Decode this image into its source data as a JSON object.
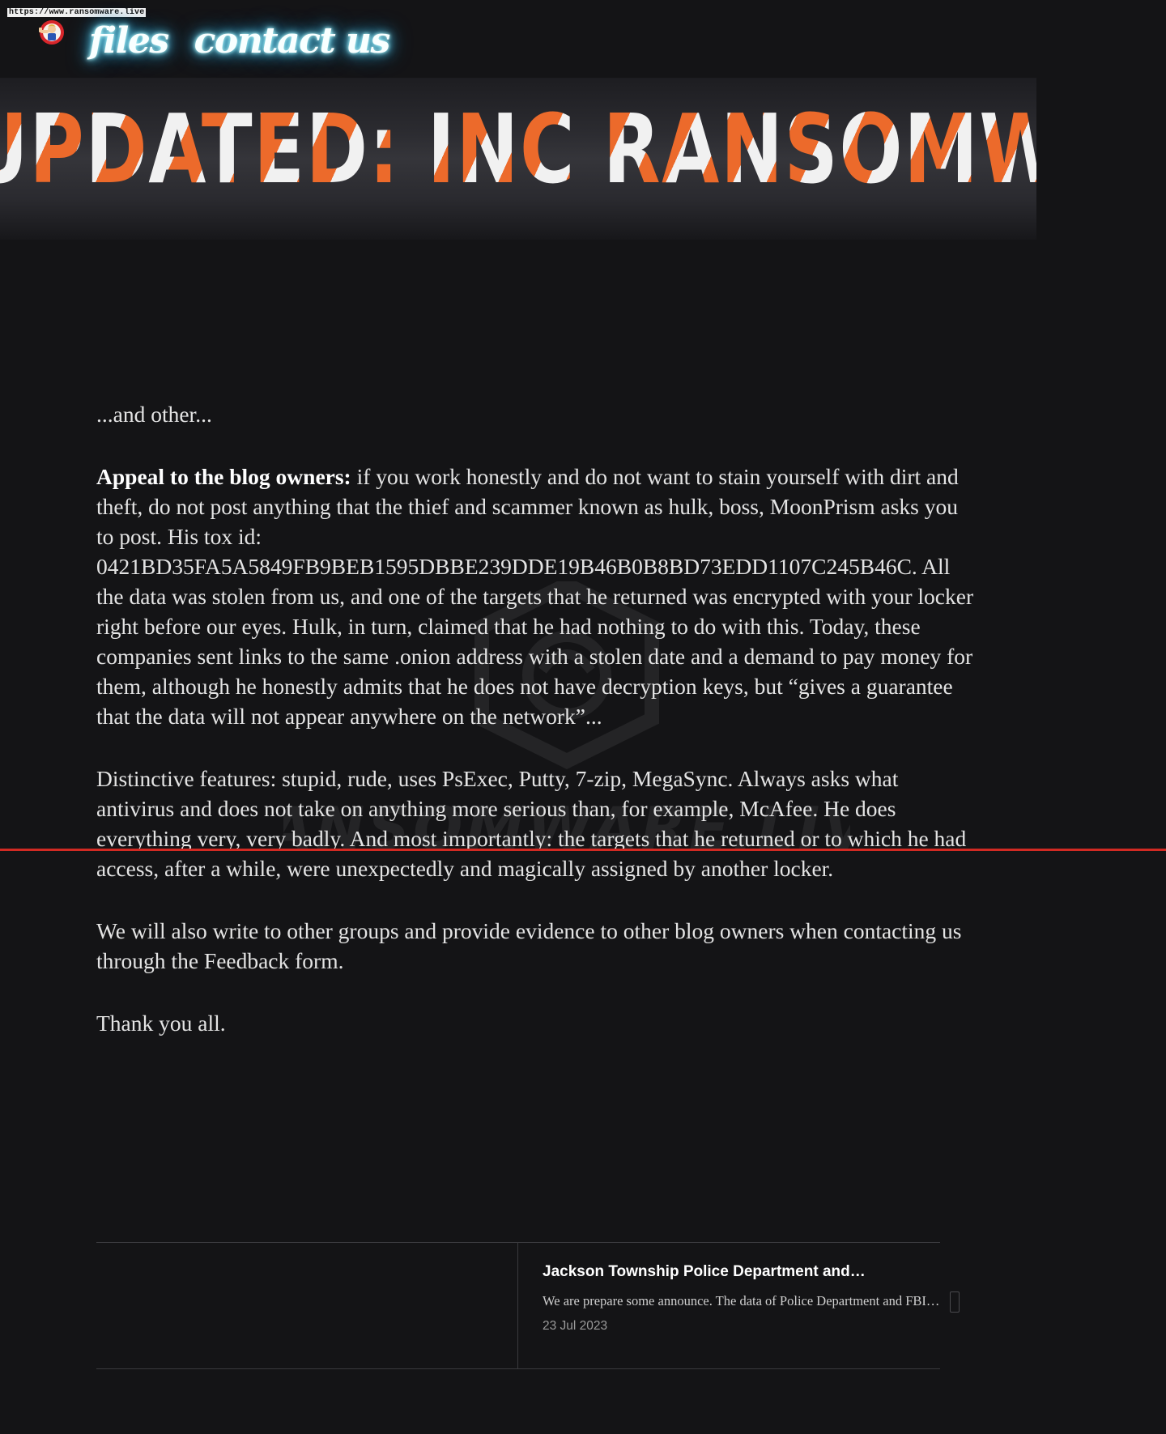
{
  "header": {
    "url_tag": "https://www.ransomware.live",
    "nav": {
      "files": "files",
      "contact": "contact us"
    }
  },
  "banner": {
    "title": "UPDATED: INC RANSOMWARE..."
  },
  "article": {
    "p1": "...and other...",
    "appeal_label": "Appeal to the blog owners:",
    "appeal_text": " if you work honestly and do not want to stain yourself with dirt and theft, do not post anything that the thief and scammer known as hulk, boss, MoonPrism asks you to post. His tox id: 0421BD35FA5A5849FB9BEB1595DBBE239DDE19B46B0B8BD73EDD1107C245B46C. All the data was stolen from us, and one of the targets that he returned was encrypted with your locker right before our eyes. Hulk, in turn, claimed that he had nothing to do with this. Today, these companies sent links to the same .onion address with a stolen date and a demand to pay money for them, although he honestly admits that he does not have decryption keys, but “gives a guarantee that the data will not appear anywhere on the network”...",
    "features": "Distinctive features: stupid, rude, uses PsExec, Putty, 7-zip, MegaSync. Always asks what antivirus and does not take on anything more serious than, for example, McAfee. He does everything very, very badly. And most importantly: the targets that he returned or to which he had access, after a while, were unexpectedly and magically assigned by another locker.",
    "groups": "We will also write to other groups and provide evidence to other blog owners when contacting us through the Feedback form.",
    "thanks": "Thank you all."
  },
  "watermark": {
    "text": "RANSOMWARE.LIVE"
  },
  "next_post": {
    "title": "Jackson Township Police Department and…",
    "excerpt": "We are prepare some announce. The data of Police Department and FBI…",
    "date": "23 Jul 2023"
  },
  "icons": {
    "mascot": "vault-boy-mascot-icon",
    "next": "chevron-right-icon",
    "watermark": "hexagon-logo-icon"
  },
  "colors": {
    "background": "#141416",
    "accent_orange": "#ec6a2b",
    "nav_glow": "#3fb8e6",
    "red_line": "#d22a23"
  }
}
